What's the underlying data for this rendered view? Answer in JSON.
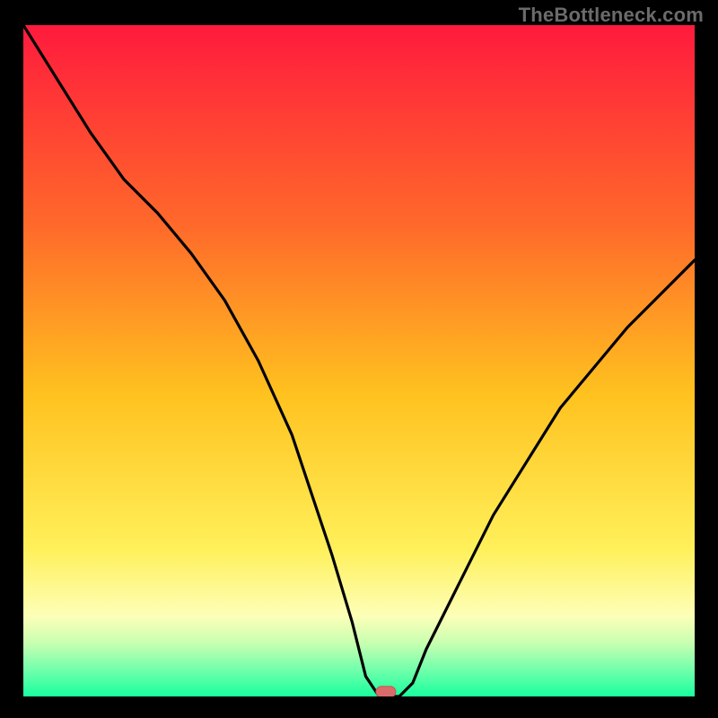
{
  "watermark": "TheBottleneck.com",
  "colors": {
    "bg": "#000000",
    "gradient_top": "#ff1a3d",
    "gradient_mid1": "#ff6a2a",
    "gradient_mid2": "#ffc21f",
    "gradient_mid3": "#fff05a",
    "gradient_pale": "#fdffb8",
    "gradient_band1": "#c9ffb0",
    "gradient_band2": "#7dffad",
    "gradient_bottom": "#18ff9e",
    "curve": "#000000",
    "marker": "#d96b6b"
  },
  "chart_data": {
    "type": "line",
    "title": "",
    "xlabel": "",
    "ylabel": "",
    "xlim": [
      0,
      100
    ],
    "ylim": [
      0,
      100
    ],
    "series": [
      {
        "name": "curve",
        "x": [
          0,
          5,
          10,
          15,
          20,
          25,
          30,
          35,
          40,
          43,
          46,
          49,
          51,
          53,
          56,
          58,
          60,
          65,
          70,
          75,
          80,
          85,
          90,
          95,
          100
        ],
        "y": [
          100,
          92,
          84,
          77,
          72,
          66,
          59,
          50,
          39,
          30,
          21,
          11,
          3,
          0,
          0,
          2,
          7,
          17,
          27,
          35,
          43,
          49,
          55,
          60,
          65
        ]
      }
    ],
    "marker": {
      "x": 54,
      "y": 0.7,
      "shape": "capsule"
    },
    "gradient_stops": [
      {
        "pos": 0.0,
        "color": "#ff1a3d"
      },
      {
        "pos": 0.3,
        "color": "#ff6a2a"
      },
      {
        "pos": 0.55,
        "color": "#ffc21f"
      },
      {
        "pos": 0.78,
        "color": "#fff05a"
      },
      {
        "pos": 0.88,
        "color": "#fdffb8"
      },
      {
        "pos": 0.92,
        "color": "#c9ffb0"
      },
      {
        "pos": 0.955,
        "color": "#7dffad"
      },
      {
        "pos": 1.0,
        "color": "#18ff9e"
      }
    ]
  }
}
